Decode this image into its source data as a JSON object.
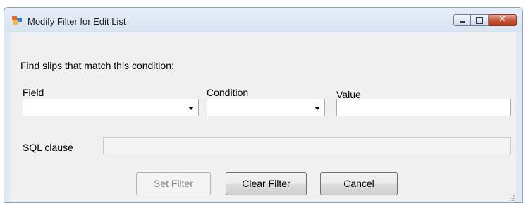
{
  "window": {
    "title": "Modify Filter for Edit List",
    "icon": "app-window-icon",
    "controls": {
      "minimize": "minimize-icon",
      "maximize": "maximize-icon",
      "close": "✕"
    }
  },
  "form": {
    "instruction": "Find slips that match this condition:",
    "field_label": "Field",
    "condition_label": "Condition",
    "value_label": "Value",
    "field_value": "",
    "condition_value": "",
    "value_value": "",
    "sql_label": "SQL clause",
    "sql_value": ""
  },
  "buttons": {
    "set_filter": "Set Filter",
    "clear_filter": "Clear Filter",
    "cancel": "Cancel"
  },
  "colors": {
    "title_bar": "#dfe8f3",
    "client": "#f0f0f0",
    "close_button": "#c55535"
  }
}
